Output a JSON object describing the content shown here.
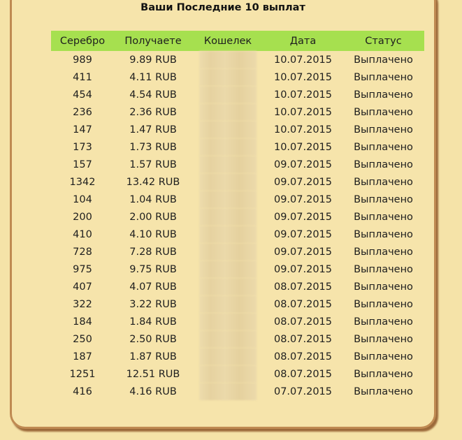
{
  "title": "Ваши Последние 10 выплат",
  "table": {
    "headers": [
      "Серебро",
      "Получаете",
      "Кошелек",
      "Дата",
      "Статус"
    ],
    "rows": [
      {
        "silver": "989",
        "receive": "9.89 RUB",
        "date": "10.07.2015",
        "status": "Выплачено"
      },
      {
        "silver": "411",
        "receive": "4.11 RUB",
        "date": "10.07.2015",
        "status": "Выплачено"
      },
      {
        "silver": "454",
        "receive": "4.54 RUB",
        "date": "10.07.2015",
        "status": "Выплачено"
      },
      {
        "silver": "236",
        "receive": "2.36 RUB",
        "date": "10.07.2015",
        "status": "Выплачено"
      },
      {
        "silver": "147",
        "receive": "1.47 RUB",
        "date": "10.07.2015",
        "status": "Выплачено"
      },
      {
        "silver": "173",
        "receive": "1.73 RUB",
        "date": "10.07.2015",
        "status": "Выплачено"
      },
      {
        "silver": "157",
        "receive": "1.57 RUB",
        "date": "09.07.2015",
        "status": "Выплачено"
      },
      {
        "silver": "1342",
        "receive": "13.42 RUB",
        "date": "09.07.2015",
        "status": "Выплачено"
      },
      {
        "silver": "104",
        "receive": "1.04 RUB",
        "date": "09.07.2015",
        "status": "Выплачено"
      },
      {
        "silver": "200",
        "receive": "2.00 RUB",
        "date": "09.07.2015",
        "status": "Выплачено"
      },
      {
        "silver": "410",
        "receive": "4.10 RUB",
        "date": "09.07.2015",
        "status": "Выплачено"
      },
      {
        "silver": "728",
        "receive": "7.28 RUB",
        "date": "09.07.2015",
        "status": "Выплачено"
      },
      {
        "silver": "975",
        "receive": "9.75 RUB",
        "date": "09.07.2015",
        "status": "Выплачено"
      },
      {
        "silver": "407",
        "receive": "4.07 RUB",
        "date": "08.07.2015",
        "status": "Выплачено"
      },
      {
        "silver": "322",
        "receive": "3.22 RUB",
        "date": "08.07.2015",
        "status": "Выплачено"
      },
      {
        "silver": "184",
        "receive": "1.84 RUB",
        "date": "08.07.2015",
        "status": "Выплачено"
      },
      {
        "silver": "250",
        "receive": "2.50 RUB",
        "date": "08.07.2015",
        "status": "Выплачено"
      },
      {
        "silver": "187",
        "receive": "1.87 RUB",
        "date": "08.07.2015",
        "status": "Выплачено"
      },
      {
        "silver": "1251",
        "receive": "12.51 RUB",
        "date": "08.07.2015",
        "status": "Выплачено"
      },
      {
        "silver": "416",
        "receive": "4.16 RUB",
        "date": "07.07.2015",
        "status": "Выплачено"
      }
    ]
  },
  "colors": {
    "background": "#f5e3a8",
    "panel": "#f6e4ab",
    "panel_border": "#bf8a52",
    "header_bg": "#a6e04f",
    "text": "#1e1e1e"
  }
}
